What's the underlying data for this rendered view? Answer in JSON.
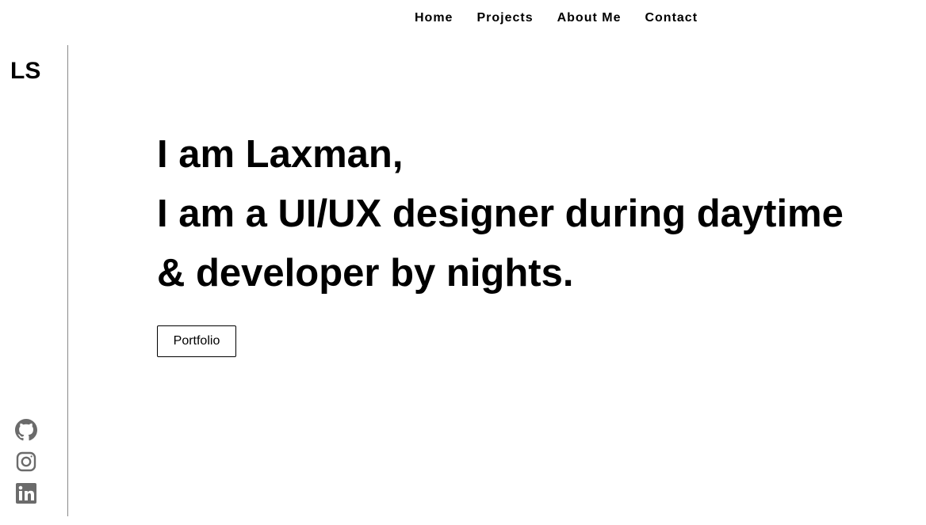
{
  "nav": {
    "items": [
      {
        "label": "Home"
      },
      {
        "label": "Projects"
      },
      {
        "label": "About Me"
      },
      {
        "label": "Contact"
      }
    ]
  },
  "sidebar": {
    "logo": "LS",
    "social": [
      {
        "icon": "github-icon"
      },
      {
        "icon": "instagram-icon"
      },
      {
        "icon": "linkedin-icon"
      }
    ],
    "icon_color": "#6b6b6b",
    "divider_color": "#8a8a8a"
  },
  "hero": {
    "line1": "I am Laxman,",
    "line2": "I am a UI/UX designer during daytime",
    "line3": "& developer by nights.",
    "button_label": "Portfolio"
  }
}
